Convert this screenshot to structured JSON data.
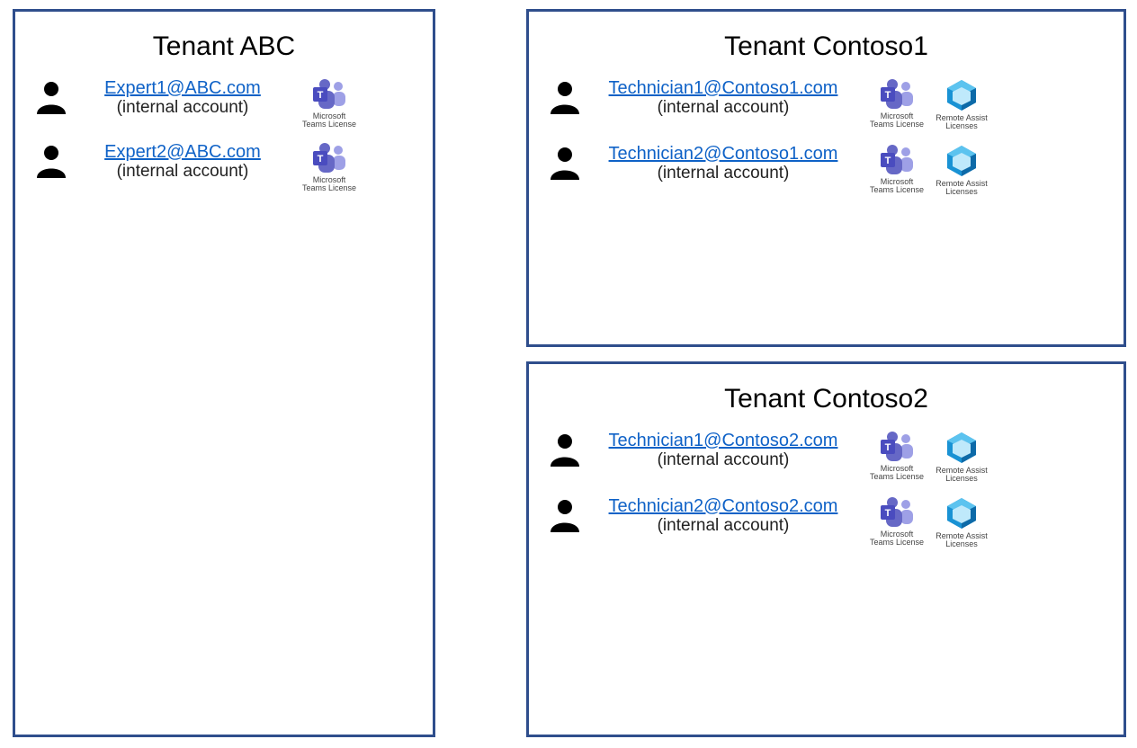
{
  "left_box": {
    "title": "Tenant ABC",
    "users": [
      {
        "email": "Expert1@ABC.com",
        "sub": "(internal account)",
        "has_teams": true,
        "has_remote_assist": false
      },
      {
        "email": "Expert2@ABC.com",
        "sub": "(internal account)",
        "has_teams": true,
        "has_remote_assist": false
      }
    ]
  },
  "right_top_box": {
    "title": "Tenant Contoso1",
    "users": [
      {
        "email": "Technician1@Contoso1.com",
        "sub": "(internal account)",
        "has_teams": true,
        "has_remote_assist": true
      },
      {
        "email": "Technician2@Contoso1.com",
        "sub": "(internal account)",
        "has_teams": true,
        "has_remote_assist": true
      }
    ]
  },
  "right_bottom_box": {
    "title": "Tenant Contoso2",
    "users": [
      {
        "email": "Technician1@Contoso2.com",
        "sub": "(internal account)",
        "has_teams": true,
        "has_remote_assist": true
      },
      {
        "email": "Technician2@Contoso2.com",
        "sub": "(internal account)",
        "has_teams": true,
        "has_remote_assist": true
      }
    ]
  },
  "license_labels": {
    "teams": "Microsoft Teams License",
    "remote_assist": "Remote Assist Licenses"
  }
}
